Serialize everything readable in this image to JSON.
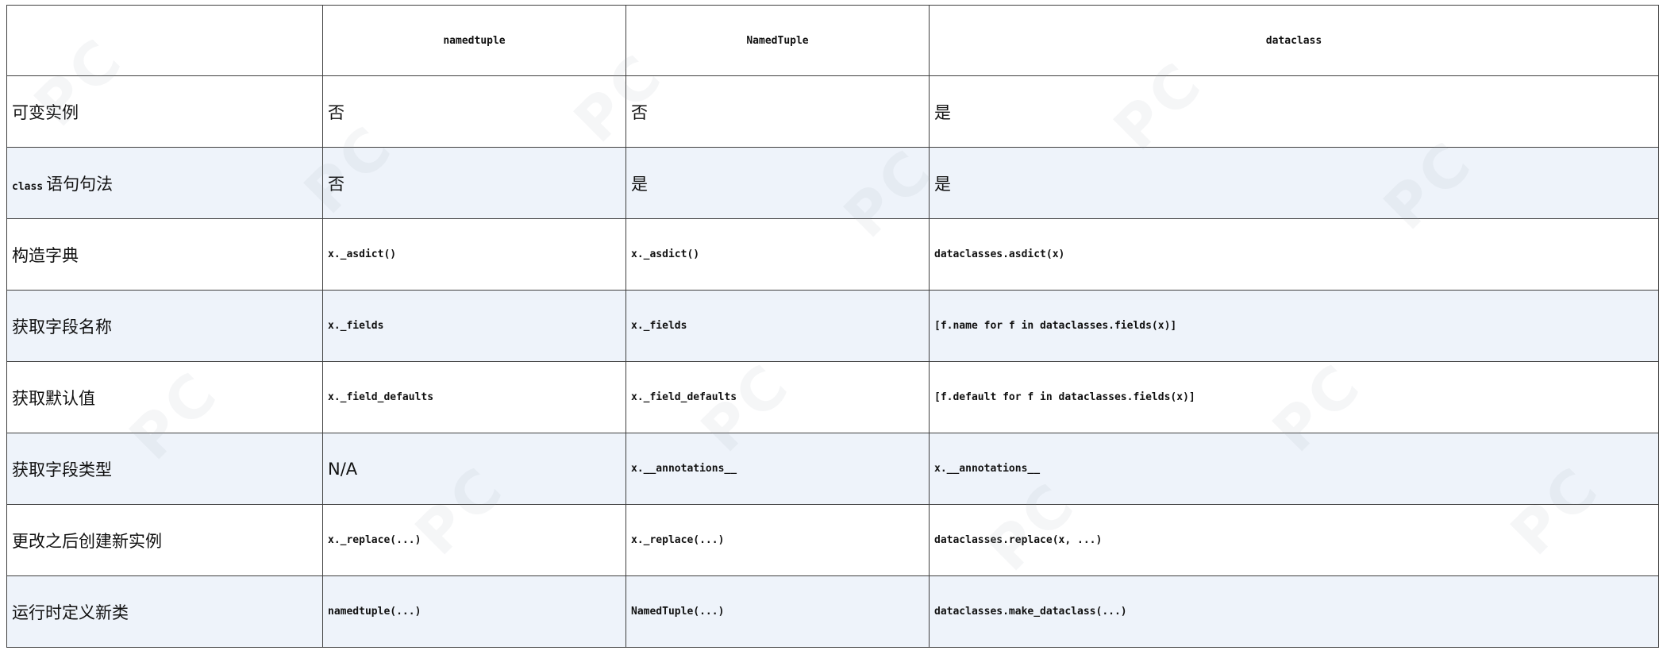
{
  "header": {
    "corner": "",
    "col1": "namedtuple",
    "col2": "NamedTuple",
    "col3": "dataclass"
  },
  "rows": [
    {
      "feature": "可变实例",
      "col1": "否",
      "col2": "否",
      "col3": "是"
    },
    {
      "feature_code": "class",
      "feature_text": "语句句法",
      "col1": "否",
      "col2": "是",
      "col3": "是"
    },
    {
      "feature": "构造字典",
      "col1": "x._asdict()",
      "col2": "x._asdict()",
      "col3": "dataclasses.asdict(x)"
    },
    {
      "feature": "获取字段名称",
      "col1": "x._fields",
      "col2": "x._fields",
      "col3": "[f.name for f in dataclasses.fields(x)]"
    },
    {
      "feature": "获取默认值",
      "col1": "x._field_defaults",
      "col2": "x._field_defaults",
      "col3": "[f.default for f in dataclasses.fields(x)]"
    },
    {
      "feature": "获取字段类型",
      "col1": "N/A",
      "col2": "x.__annotations__",
      "col3": "x.__annotations__"
    },
    {
      "feature": "更改之后创建新实例",
      "col1": "x._replace(...)",
      "col2": "x._replace(...)",
      "col3": "dataclasses.replace(x, ...)"
    },
    {
      "feature": "运行时定义新类",
      "col1": "namedtuple(...)",
      "col2": "NamedTuple(...)",
      "col3": "dataclasses.make_dataclass(...)"
    }
  ],
  "colors": {
    "alt_row_bg": "#eef3fa",
    "border": "#3f3f3f"
  }
}
